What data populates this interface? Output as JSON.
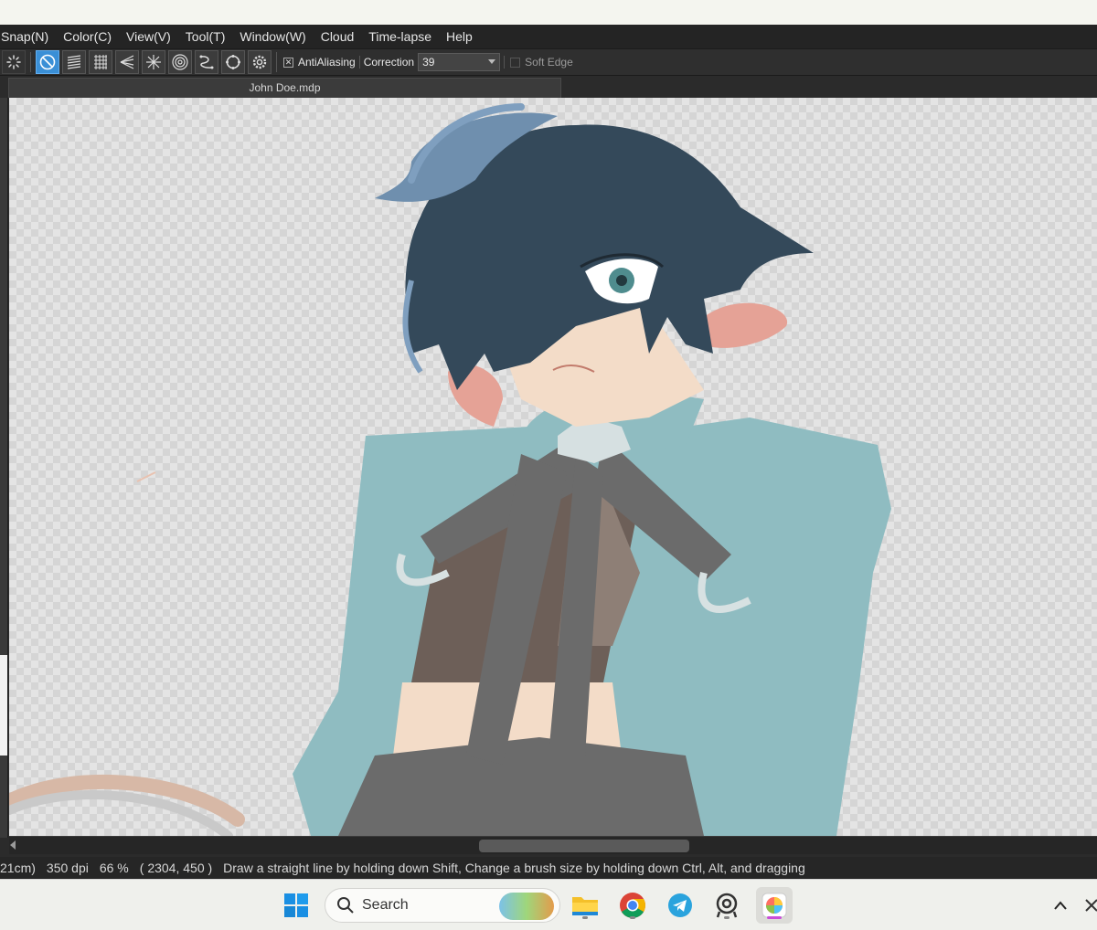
{
  "menubar": {
    "items": [
      "Snap(N)",
      "Color(C)",
      "View(V)",
      "Tool(T)",
      "Window(W)",
      "Cloud",
      "Time-lapse",
      "Help"
    ]
  },
  "toolbar": {
    "tools": [
      "snap-off",
      "parallel-lines",
      "grid",
      "perspective",
      "radial",
      "concentric",
      "curve",
      "circle",
      "settings"
    ],
    "antialiasing_label": "AntiAliasing",
    "antialiasing_checked": true,
    "correction_label": "Correction",
    "correction_value": "39",
    "soft_edge_label": "Soft Edge",
    "soft_edge_checked": false
  },
  "document": {
    "tab_title": "John Doe.mdp"
  },
  "statusbar": {
    "size": "21cm)",
    "dpi": "350 dpi",
    "zoom": "66 %",
    "coordinates": "( 2304, 450 )",
    "hint": "Draw a straight line by holding down Shift, Change a brush size by holding down Ctrl, Alt, and dragging"
  },
  "taskbar": {
    "search_label": "Search",
    "apps": [
      "start",
      "file-explorer",
      "chrome",
      "telegram",
      "webcam-app",
      "medibang-paint"
    ]
  },
  "colors": {
    "hair": "#34495a",
    "hair_highlight": "#7f9fbf",
    "jacket": "#8fbcc1",
    "shirt": "#6b6b6b",
    "skin": "#f3dcc8",
    "accent_active": "#3a8fd6"
  }
}
